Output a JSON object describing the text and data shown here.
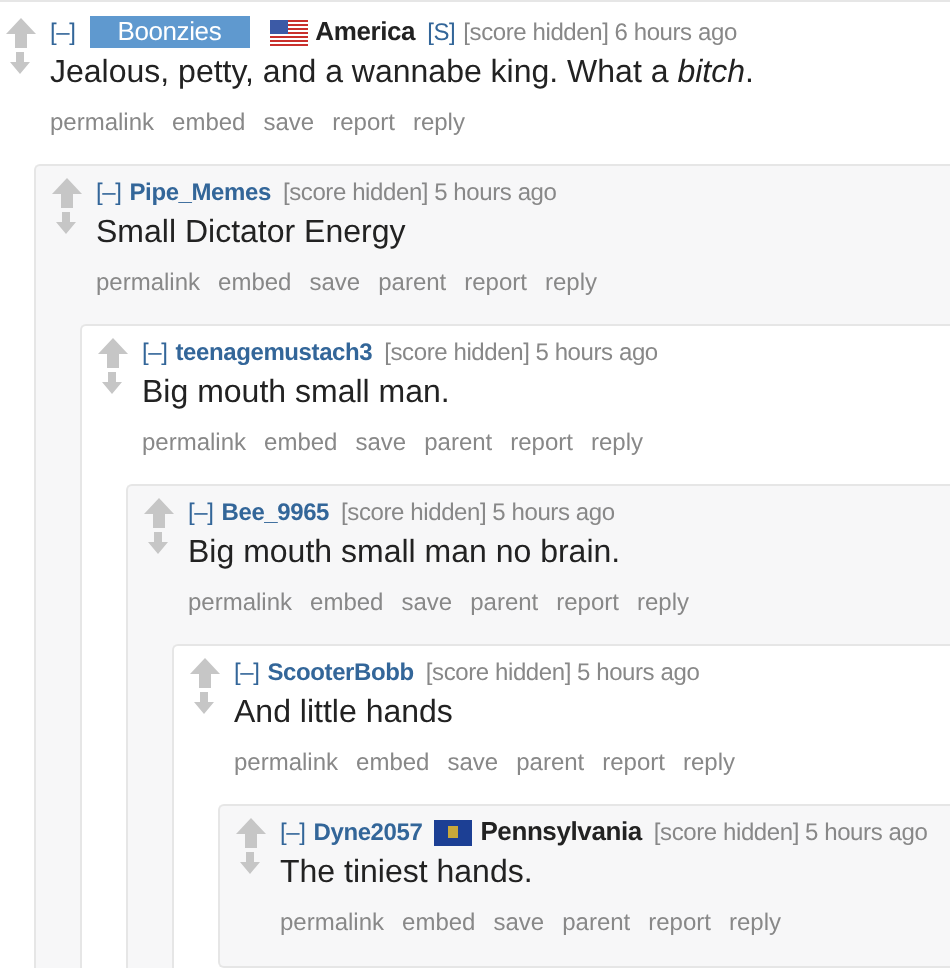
{
  "comments": [
    {
      "collapse": "[–]",
      "author": "Boonzies",
      "submitter": true,
      "flair": {
        "kind": "us",
        "text": "America"
      },
      "badge": "[S]",
      "score": "[score hidden]",
      "time": "6 hours ago",
      "body": "Jealous, petty, and a wannabe king. What a *bitch*.",
      "actions": [
        "permalink",
        "embed",
        "save",
        "report",
        "reply"
      ],
      "children": [
        {
          "collapse": "[–]",
          "author": "Pipe_Memes",
          "submitter": false,
          "score": "[score hidden]",
          "time": "5 hours ago",
          "body": "Small Dictator Energy",
          "actions": [
            "permalink",
            "embed",
            "save",
            "parent",
            "report",
            "reply"
          ],
          "children": [
            {
              "collapse": "[–]",
              "author": "teenagemustach3",
              "submitter": false,
              "score": "[score hidden]",
              "time": "5 hours ago",
              "body": "Big mouth small man.",
              "actions": [
                "permalink",
                "embed",
                "save",
                "parent",
                "report",
                "reply"
              ],
              "children": [
                {
                  "collapse": "[–]",
                  "author": "Bee_9965",
                  "submitter": false,
                  "score": "[score hidden]",
                  "time": "5 hours ago",
                  "body": "Big mouth small man no brain.",
                  "actions": [
                    "permalink",
                    "embed",
                    "save",
                    "parent",
                    "report",
                    "reply"
                  ],
                  "children": [
                    {
                      "collapse": "[–]",
                      "author": "ScooterBobb",
                      "submitter": false,
                      "score": "[score hidden]",
                      "time": "5 hours ago",
                      "body": "And little hands",
                      "actions": [
                        "permalink",
                        "embed",
                        "save",
                        "parent",
                        "report",
                        "reply"
                      ],
                      "children": [
                        {
                          "collapse": "[–]",
                          "author": "Dyne2057",
                          "submitter": false,
                          "flair": {
                            "kind": "pa",
                            "text": "Pennsylvania"
                          },
                          "score": "[score hidden]",
                          "time": "5 hours ago",
                          "body": "The tiniest hands.",
                          "actions": [
                            "permalink",
                            "embed",
                            "save",
                            "parent",
                            "report",
                            "reply"
                          ]
                        }
                      ]
                    }
                  ]
                }
              ]
            }
          ]
        }
      ]
    }
  ]
}
